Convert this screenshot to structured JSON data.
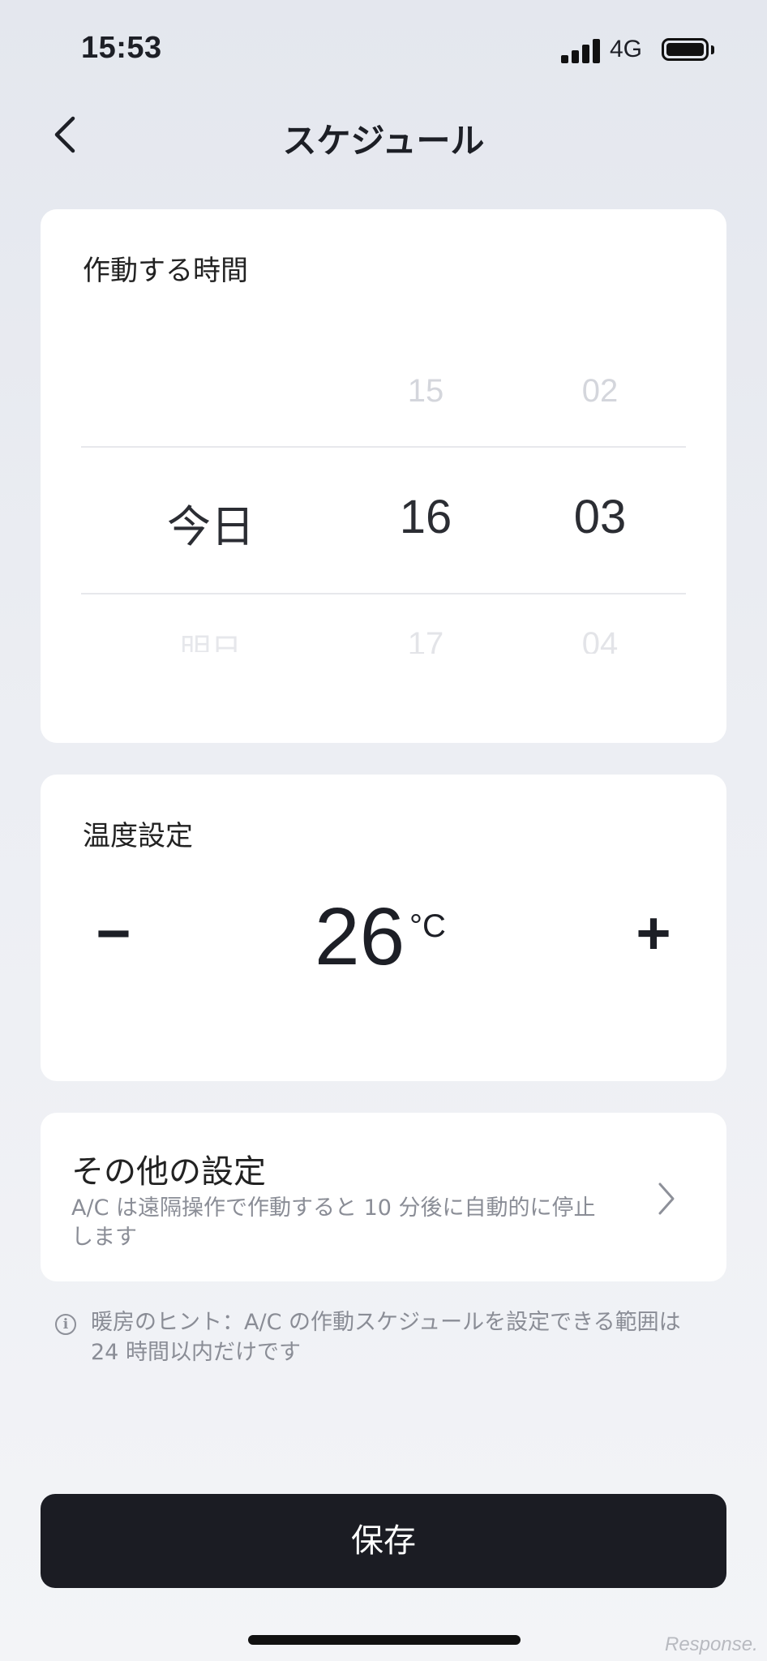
{
  "status_bar": {
    "time": "15:53",
    "network": "4G"
  },
  "header": {
    "title": "スケジュール",
    "back_icon": "chevron-left-icon"
  },
  "schedule": {
    "title": "作動する時間",
    "day_column": {
      "next": "明日",
      "selected": "今日"
    },
    "hour_column": {
      "prev": "15",
      "selected": "16",
      "next": "17"
    },
    "minute_column": {
      "prev": "02",
      "selected": "03",
      "next": "04"
    }
  },
  "temperature": {
    "title": "温度設定",
    "minus_label": "−",
    "plus_label": "+",
    "value": "26",
    "unit": "°C"
  },
  "other_settings": {
    "title": "その他の設定",
    "description_line1": "A/C は遠隔操作で作動すると 10 分後に自動的に停止",
    "description_line2": "します",
    "chevron_icon": "chevron-right-icon"
  },
  "hint": {
    "icon": "info-icon",
    "icon_glyph": "i",
    "line1": "暖房のヒント：A/C の作動スケジュールを設定できる範囲は",
    "line2": "24 時間以内だけです"
  },
  "save_label": "保存",
  "watermark": "Response."
}
